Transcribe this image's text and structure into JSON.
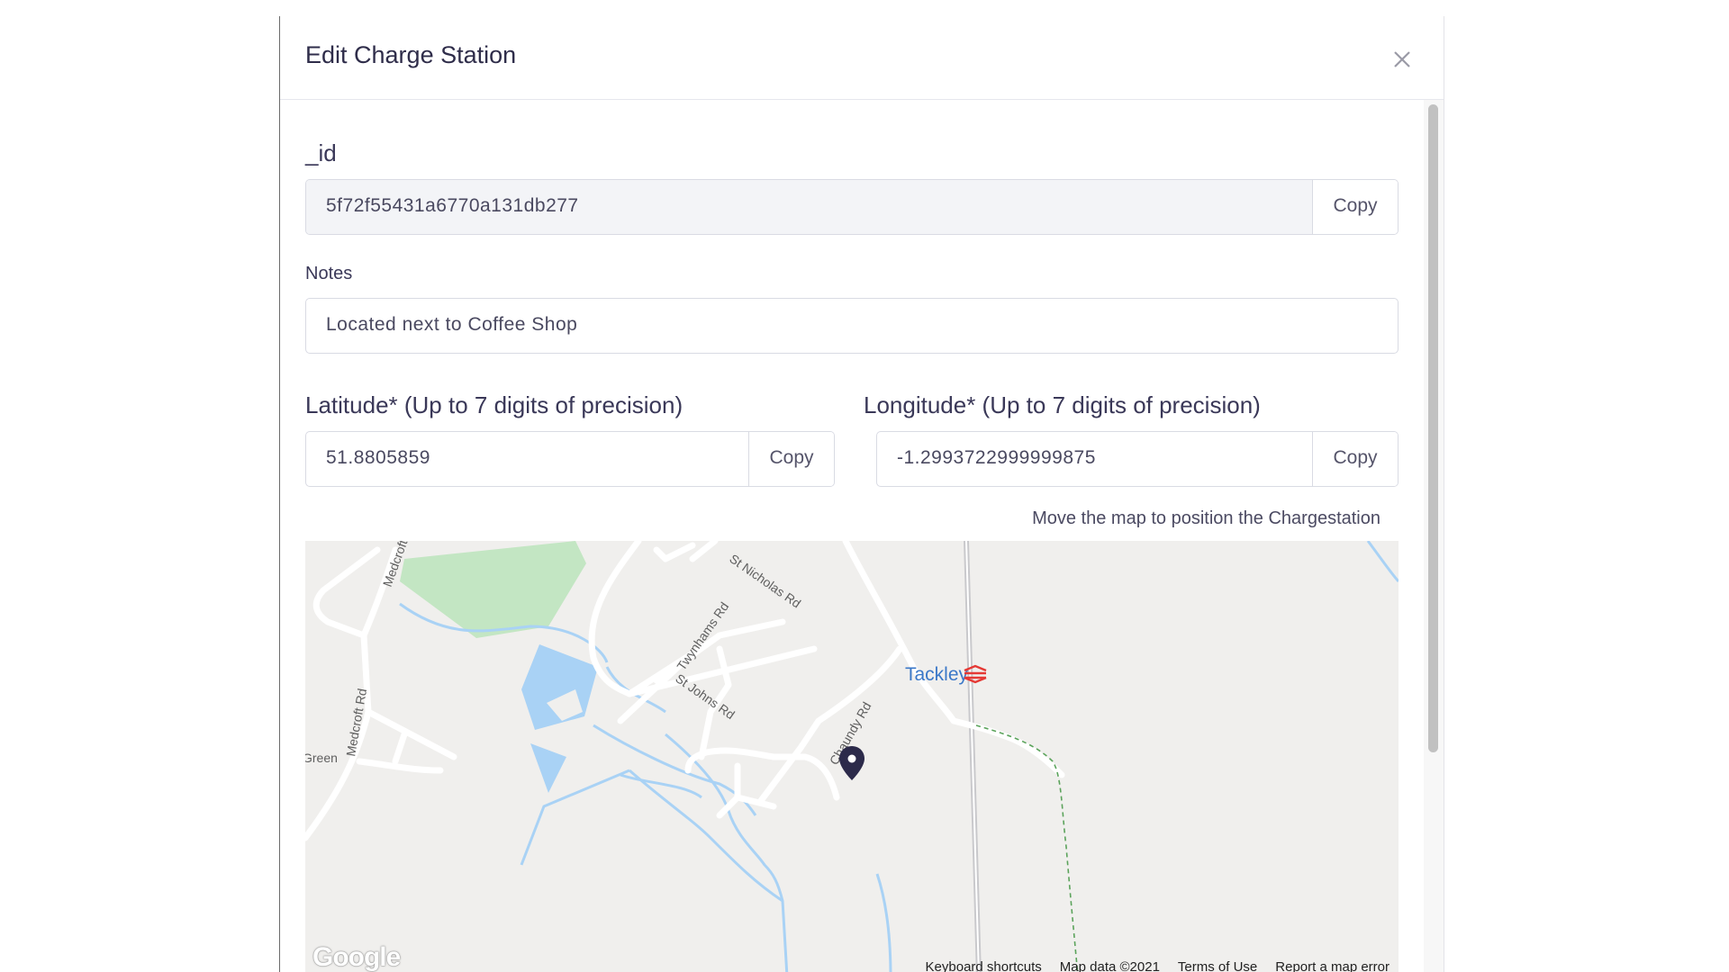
{
  "modal": {
    "title": "Edit Charge Station"
  },
  "fields": {
    "id": {
      "label": "_id",
      "value": "5f72f55431a6770a131db277",
      "copy_label": "Copy"
    },
    "notes": {
      "label": "Notes",
      "value": "Located next to Coffee Shop"
    },
    "latitude": {
      "label": "Latitude* (Up to 7 digits of precision)",
      "value": "51.8805859",
      "copy_label": "Copy"
    },
    "longitude": {
      "label": "Longitude* (Up to 7 digits of precision)",
      "value": "-1.2993722999999875",
      "copy_label": "Copy"
    }
  },
  "map": {
    "hint": "Move the map to position the Chargestation",
    "logo": "Google",
    "station_label": "Tackley",
    "streets": {
      "st_nicholas": "St Nicholas Rd",
      "twynhams": "Twynhams Rd",
      "st_johns": "St Johns Rd",
      "medcroft": "Medcroft Rd",
      "medcroft_top": "Medcroft",
      "chaundy": "Chaundy Rd",
      "green": "Green"
    },
    "footer": {
      "shortcuts": "Keyboard shortcuts",
      "data": "Map data ©2021",
      "terms": "Terms of Use",
      "report": "Report a map error"
    },
    "colors": {
      "water": "#a9d2f5",
      "park": "#c3e6c3",
      "road": "#ffffff",
      "land": "#f0efed",
      "pin": "#2c2a4a"
    }
  }
}
